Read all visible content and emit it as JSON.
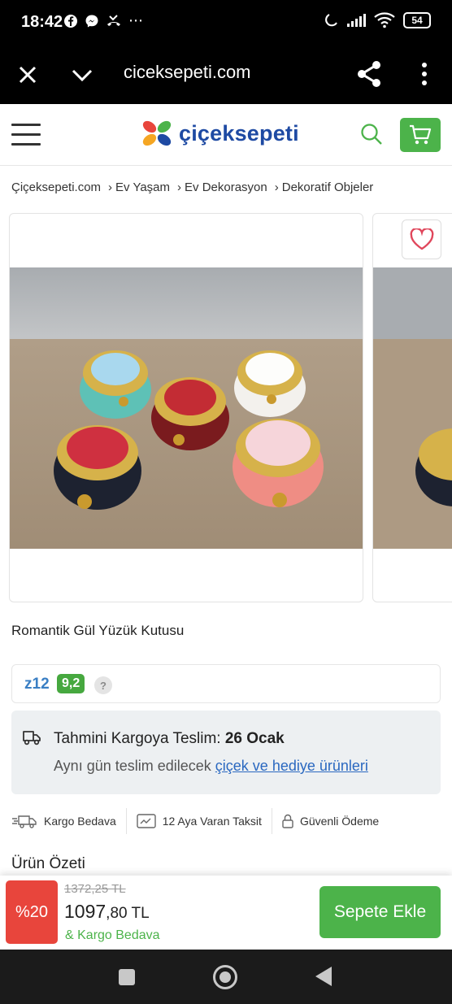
{
  "status_bar": {
    "time": "18:42",
    "battery": "54",
    "icons": [
      "facebook-icon",
      "messenger-icon",
      "missed-call-icon",
      "more-dots-icon",
      "moon-icon",
      "signal-icon",
      "wifi-icon",
      "battery-icon"
    ]
  },
  "browser": {
    "url": "ciceksepeti.com",
    "icons": [
      "close-icon",
      "chevron-down-icon",
      "share-icon",
      "more-vert-icon"
    ]
  },
  "header": {
    "logo_text": "çiçeksepeti",
    "brand_color": "#1e4aa3",
    "accent_green": "#4cb34a",
    "icons": [
      "menu-icon",
      "search-icon",
      "cart-icon"
    ]
  },
  "breadcrumb": [
    "Çiçeksepeti.com",
    "Ev Yaşam",
    "Ev Dekorasyon",
    "Dekoratif Objeler"
  ],
  "product": {
    "title": "Romantik Gül Yüzük Kutusu",
    "image_alt": "product-photo",
    "favorite_icon": "heart-icon"
  },
  "seller": {
    "name": "z12",
    "score": "9,2",
    "help": "?"
  },
  "delivery": {
    "label": "Tahmini Kargoya Teslim:",
    "date": "26 Ocak",
    "line2_prefix": "Aynı gün teslim edilecek",
    "line2_link": "çiçek ve hediye ürünleri"
  },
  "features": [
    {
      "icon": "truck-fast-icon",
      "label": "Kargo Bedava"
    },
    {
      "icon": "card-icon",
      "label": "12 Aya Varan Taksit"
    },
    {
      "icon": "lock-icon",
      "label": "Güvenli Ödeme"
    }
  ],
  "summary_title": "Ürün Özeti",
  "price": {
    "discount": "%20",
    "old": "1372,25 TL",
    "new_int": "1097",
    "new_dec": ",80 TL",
    "free_shipping": "& Kargo Bedava",
    "add_to_cart": "Sepete Ekle",
    "discount_color": "#e8453c"
  },
  "nav": [
    "recents-icon",
    "home-icon",
    "back-icon"
  ]
}
